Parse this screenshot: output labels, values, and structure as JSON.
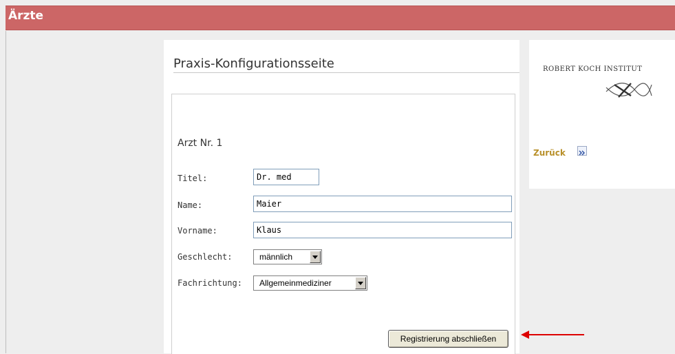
{
  "header": {
    "title": "Ärzte"
  },
  "main": {
    "page_title": "Praxis-Konfigurationsseite",
    "form": {
      "heading": "Arzt Nr. 1",
      "titel_label": "Titel:",
      "titel_value": "Dr. med",
      "name_label": "Name:",
      "name_value": "Maier",
      "vorname_label": "Vorname:",
      "vorname_value": "Klaus",
      "geschlecht_label": "Geschlecht:",
      "geschlecht_value": "männlich",
      "fachrichtung_label": "Fachrichtung:",
      "fachrichtung_value": "Allgemeinmediziner",
      "submit_label": "Registrierung abschließen"
    }
  },
  "sidebar": {
    "institute_name": "ROBERT KOCH INSTITUT",
    "back_label": "Zurück",
    "back_icon": "double-chevron-right-icon",
    "logo_icon": "rki-logo-icon"
  },
  "colors": {
    "header": "#cc6666",
    "link": "#b8902a",
    "annotation_arrow": "#dd0000"
  }
}
